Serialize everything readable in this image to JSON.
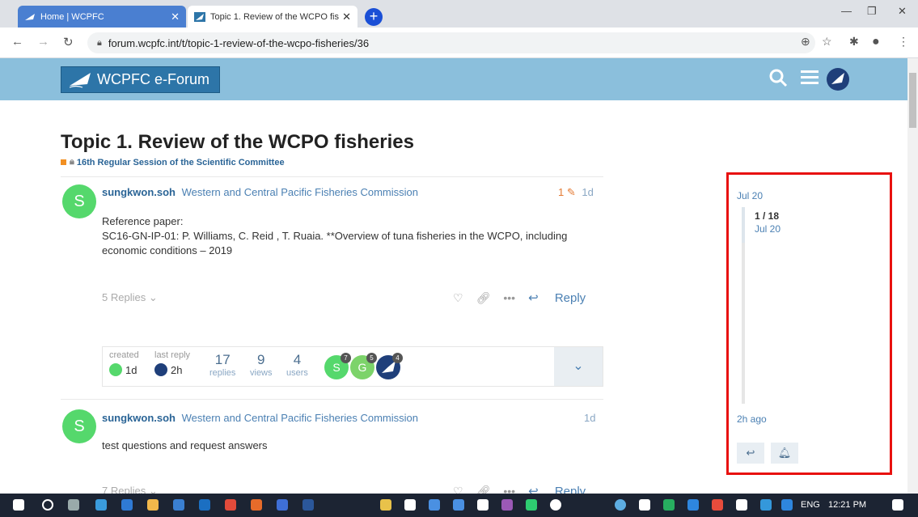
{
  "browser": {
    "tabs": [
      {
        "title": "Home | WCPFC"
      },
      {
        "title": "Topic 1. Review of the WCPO fish"
      }
    ],
    "url": "forum.wcpfc.int/t/topic-1-review-of-the-wcpo-fisheries/36"
  },
  "site": {
    "logo_text": "WCPFC e-Forum"
  },
  "topic": {
    "title": "Topic 1. Review of the WCPO fisheries",
    "category": "16th Regular Session of the Scientific Committee"
  },
  "posts": [
    {
      "avatar_letter": "S",
      "username": "sungkwon.soh",
      "fullname": "Western and Central Pacific Fisheries Commission",
      "edits": "1",
      "date": "1d",
      "body_line1": "Reference paper:",
      "body_line2": "SC16-GN-IP-01: P. Williams, C. Reid , T. Ruaia. **Overview of tuna fisheries in the WCPO, including economic conditions – 2019",
      "replies": "5 Replies",
      "reply_label": "Reply"
    },
    {
      "avatar_letter": "S",
      "username": "sungkwon.soh",
      "fullname": "Western and Central Pacific Fisheries Commission",
      "date": "1d",
      "body_line1": "test questions and request answers",
      "replies": "7 Replies",
      "reply_label": "Reply"
    }
  ],
  "topic_map": {
    "created_label": "created",
    "created_value": "1d",
    "last_reply_label": "last reply",
    "last_reply_value": "2h",
    "replies_num": "17",
    "replies_label": "replies",
    "views_num": "9",
    "views_label": "views",
    "users_num": "4",
    "users_label": "users",
    "user_avatars": [
      {
        "letter": "S",
        "count": "7",
        "color": "#55d86c"
      },
      {
        "letter": "G",
        "count": "5",
        "color": "#7cd36a"
      },
      {
        "letter": "",
        "count": "4",
        "color": "#1f3f7a"
      }
    ]
  },
  "timeline": {
    "start_date": "Jul 20",
    "position": "1 / 18",
    "position_date": "Jul 20",
    "end_label": "2h ago"
  },
  "taskbar": {
    "lang": "ENG",
    "time": "12:21 PM"
  }
}
